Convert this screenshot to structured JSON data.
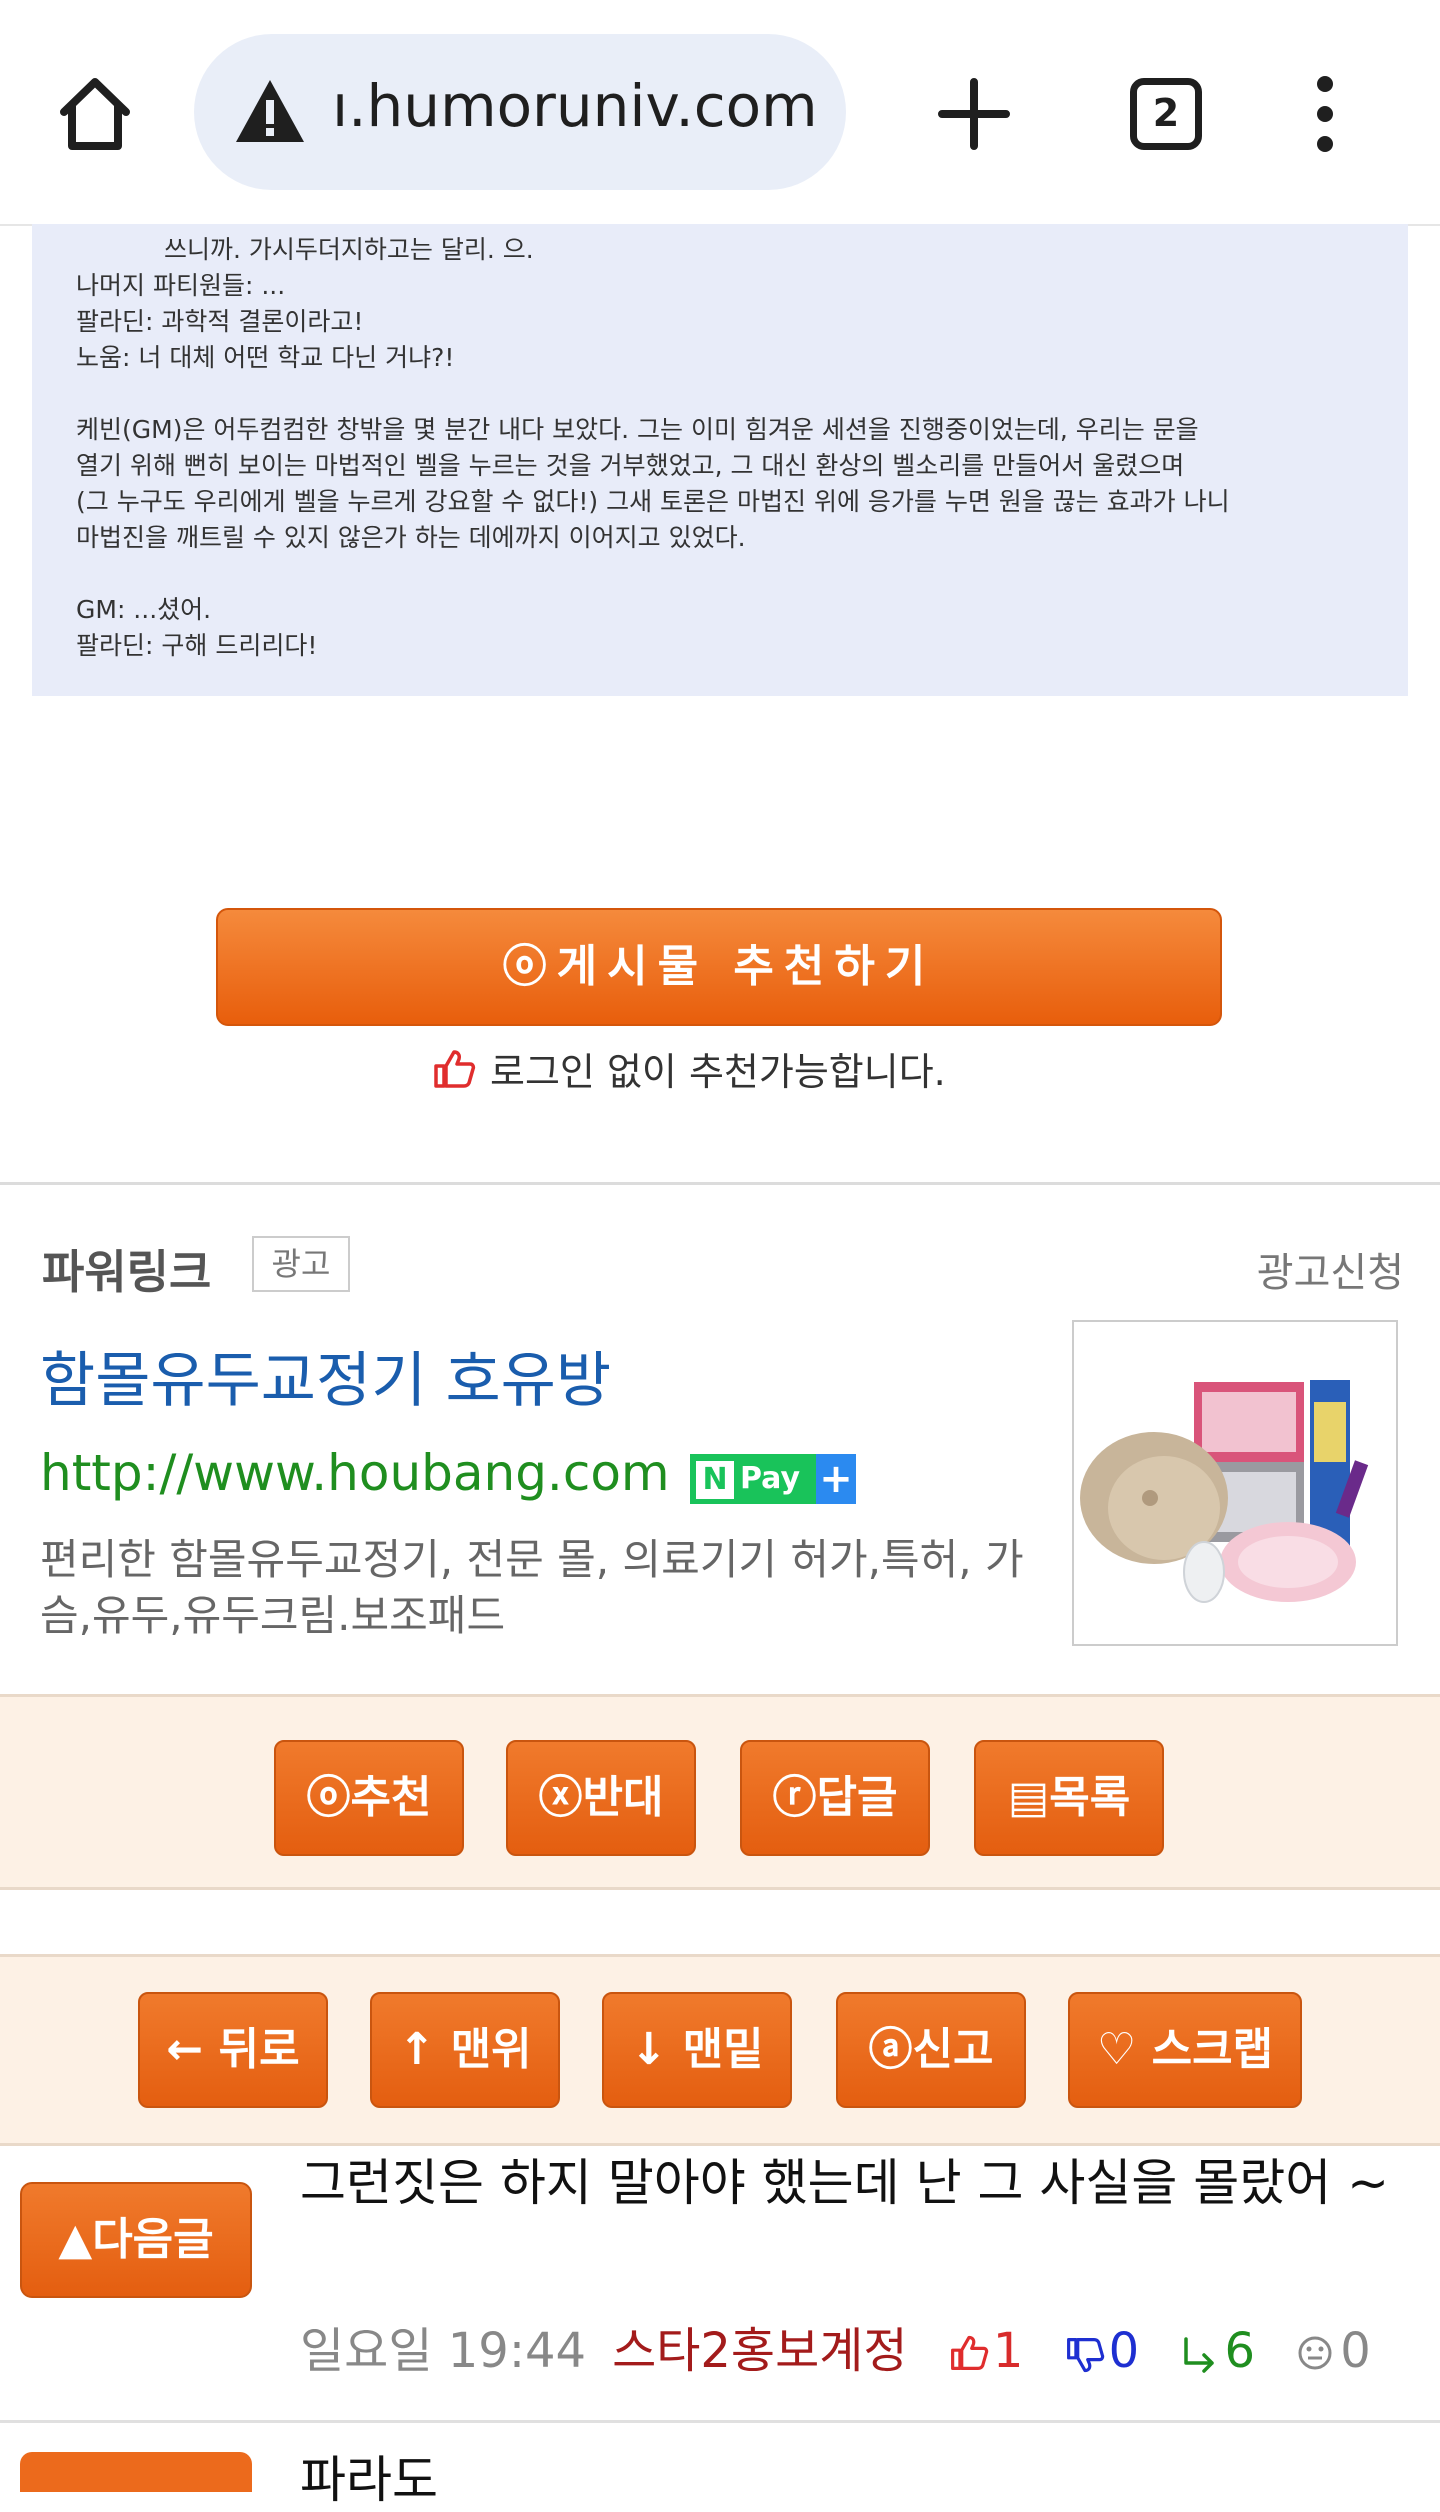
{
  "browser": {
    "url": "ı.humoruniv.com",
    "tab_count": "2"
  },
  "quote": {
    "lines": [
      "쓰니까. 가시두더지하고는 달리. 으.",
      "나머지 파티원들: ...",
      "팔라딘: 과학적 결론이라고!",
      "노움: 너 대체 어떤 학교 다닌 거냐?!",
      "",
      "케빈(GM)은 어두컴컴한 창밖을 몇 분간 내다 보았다. 그는 이미 힘겨운 세션을 진행중이었는데, 우리는 문을",
      "열기 위해 뻔히 보이는 마법적인 벨을 누르는 것을 거부했었고, 그 대신 환상의 벨소리를 만들어서 울렸으며",
      "(그 누구도 우리에게 벨을 누르게 강요할 수 없다!) 그새 토론은 마법진 위에 응가를 누면 원을 끊는 효과가 나니",
      "마법진을 깨트릴 수 있지 않은가 하는 데에까지 이어지고 있었다.",
      "",
      "GM: ...셨어.",
      "팔라딘: 구해 드리리다!"
    ]
  },
  "recommend": {
    "button_label": "ⓞ게시물  추천하기",
    "note": "로그인 없이 추천가능합니다."
  },
  "ad": {
    "brand": "파워링크",
    "tag": "광고",
    "apply": "광고신청",
    "title": "함몰유두교정기 호유방",
    "url": "http://www.houbang.com",
    "npay": "Pay",
    "description": "편리한 함몰유두교정기, 전문 몰, 의료기기 허가,특허, 가슴,유두,유두크림.보조패드"
  },
  "vote_bar": {
    "buttons": [
      "ⓞ추천",
      "ⓧ반대",
      "ⓡ답글",
      "▤목록"
    ]
  },
  "nav_bar": {
    "buttons": [
      "← 뒤로",
      "↑ 맨위",
      "↓ 맨밑",
      "ⓐ신고",
      "♡ 스크랩"
    ]
  },
  "next_post": {
    "label": "▲다음글",
    "title": "그런짓은 하지 말아야 했는데 난 그 사실을 몰랐어 ~",
    "date": "일요일 19:44",
    "author": "스타2홍보계정",
    "up": "1",
    "down": "0",
    "replies": "6",
    "views": "0"
  },
  "peek_post": {
    "title": "파라도"
  },
  "colors": {
    "accent_orange": "#e8600f",
    "quote_bg": "#e8ecf9",
    "bar_bg": "#fdf1e5",
    "link_blue": "#1a5dad",
    "url_green": "#1f8e1f",
    "author_red": "#a31b1b",
    "up_red": "#d82b2b",
    "down_blue": "#1e2fd1",
    "reply_green": "#1f8e1f"
  }
}
